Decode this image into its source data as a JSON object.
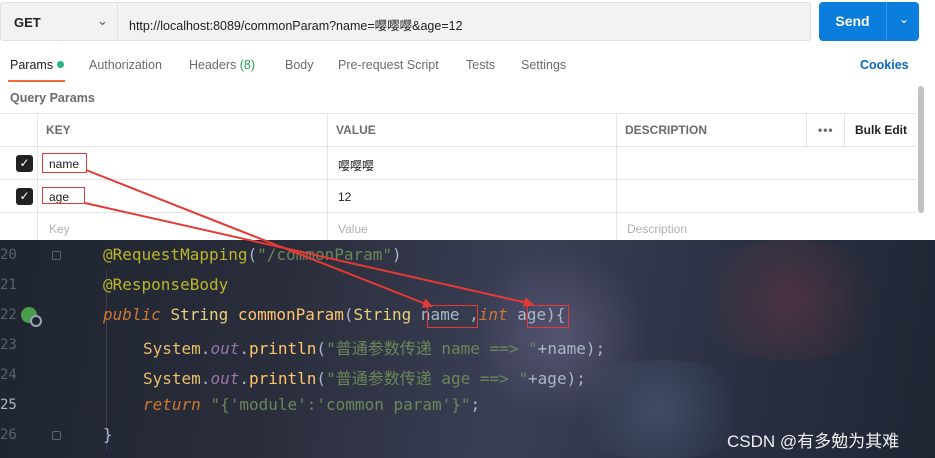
{
  "request": {
    "method": "GET",
    "url": "http://localhost:8089/commonParam?name=嘤嘤嘤&age=12",
    "send_label": "Send"
  },
  "tabs": {
    "params": "Params",
    "authorization": "Authorization",
    "headers": "Headers",
    "headers_count": "(8)",
    "body": "Body",
    "prerequest": "Pre-request Script",
    "tests": "Tests",
    "settings": "Settings",
    "cookies": "Cookies"
  },
  "query_params": {
    "title": "Query Params",
    "columns": {
      "key": "KEY",
      "value": "VALUE",
      "description": "DESCRIPTION",
      "more": "•••",
      "bulk_edit": "Bulk Edit"
    },
    "rows": [
      {
        "key": "name",
        "value": "嘤嘤嘤",
        "checked": true
      },
      {
        "key": "age",
        "value": "12",
        "checked": true
      }
    ],
    "placeholder": {
      "key": "Key",
      "value": "Value",
      "description": "Description"
    }
  },
  "editor": {
    "line_numbers": [
      "20",
      "21",
      "22",
      "23",
      "24",
      "25",
      "26"
    ],
    "mapping_path": "\"/commonParam\"",
    "response_body": "@ResponseBody",
    "request_mapping": "@RequestMapping",
    "method_name": "commonParam",
    "param1_name": "name",
    "param2_name": "age",
    "print1_str": "\"普通参数传递 name ==> \"",
    "print1_var": "name",
    "print2_str": "\"普通参数传递 age ==> \"",
    "print2_var": "age",
    "return_str": "\"{'module':'common param'}\"",
    "kw_public": "public",
    "kw_int": "int",
    "kw_return": "return",
    "type_string": "String",
    "system": "System",
    "out": "out",
    "println": "println",
    "watermark": "CSDN @有多勉为其难"
  },
  "colors": {
    "send": "#0b7ddd",
    "active_tab": "#f26b3a",
    "annotation_red": "#e53935"
  }
}
